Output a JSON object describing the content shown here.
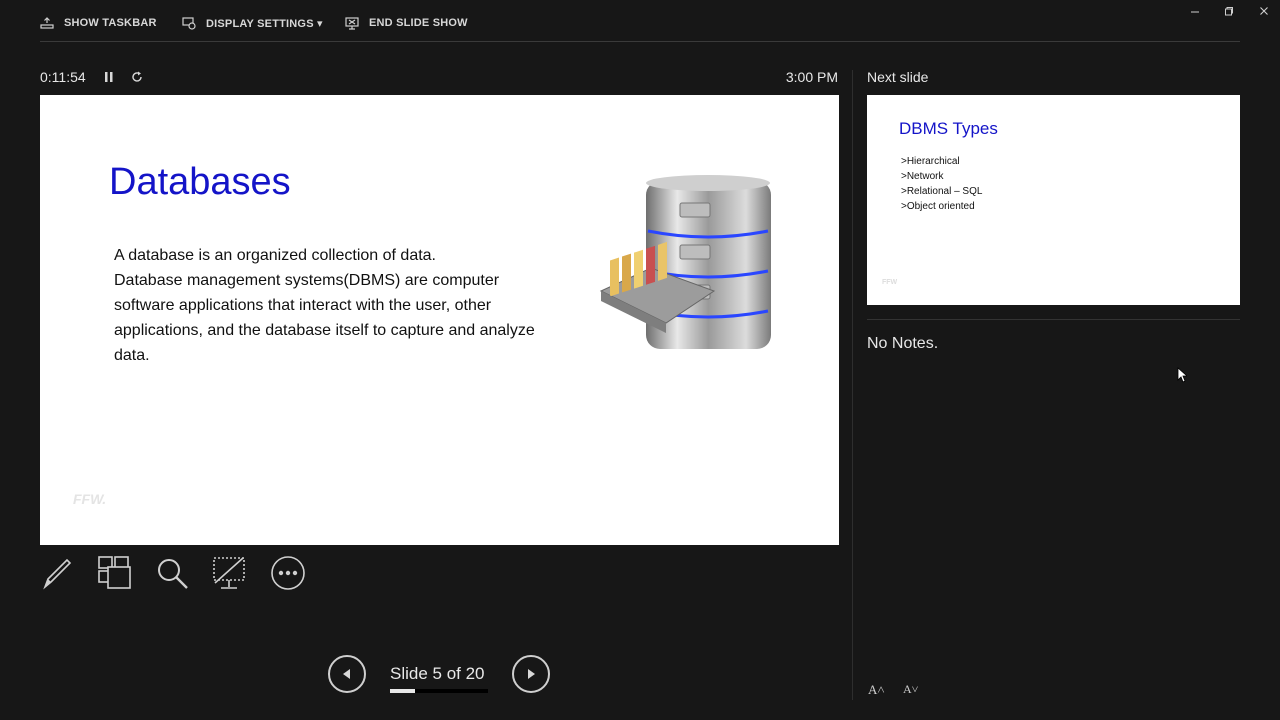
{
  "toolbar": {
    "show_taskbar": "SHOW TASKBAR",
    "display_settings": "DISPLAY SETTINGS ▾",
    "end_slide_show": "END SLIDE SHOW"
  },
  "presenter": {
    "elapsed_time": "0:11:54",
    "clock": "3:00 PM",
    "next_slide_label": "Next slide",
    "notes": "No Notes.",
    "slide_counter": "Slide 5 of 20",
    "progress": 0.25
  },
  "current_slide": {
    "title": "Databases",
    "body_lines": [
      "A database is an organized collection of data.",
      "Database management systems(DBMS) are computer",
      "software applications that interact with the user, other",
      "applications, and the database itself to capture and analyze",
      "data."
    ],
    "logo": "FFW."
  },
  "next_slide": {
    "title": "DBMS Types",
    "items": [
      ">Hierarchical",
      ">Network",
      ">Relational – SQL",
      ">Object oriented"
    ],
    "logo": "FFW"
  },
  "font_controls": {
    "increase": "A˄",
    "decrease": "A˅"
  },
  "colors": {
    "accent_title": "#1414c8",
    "background": "#171717"
  }
}
